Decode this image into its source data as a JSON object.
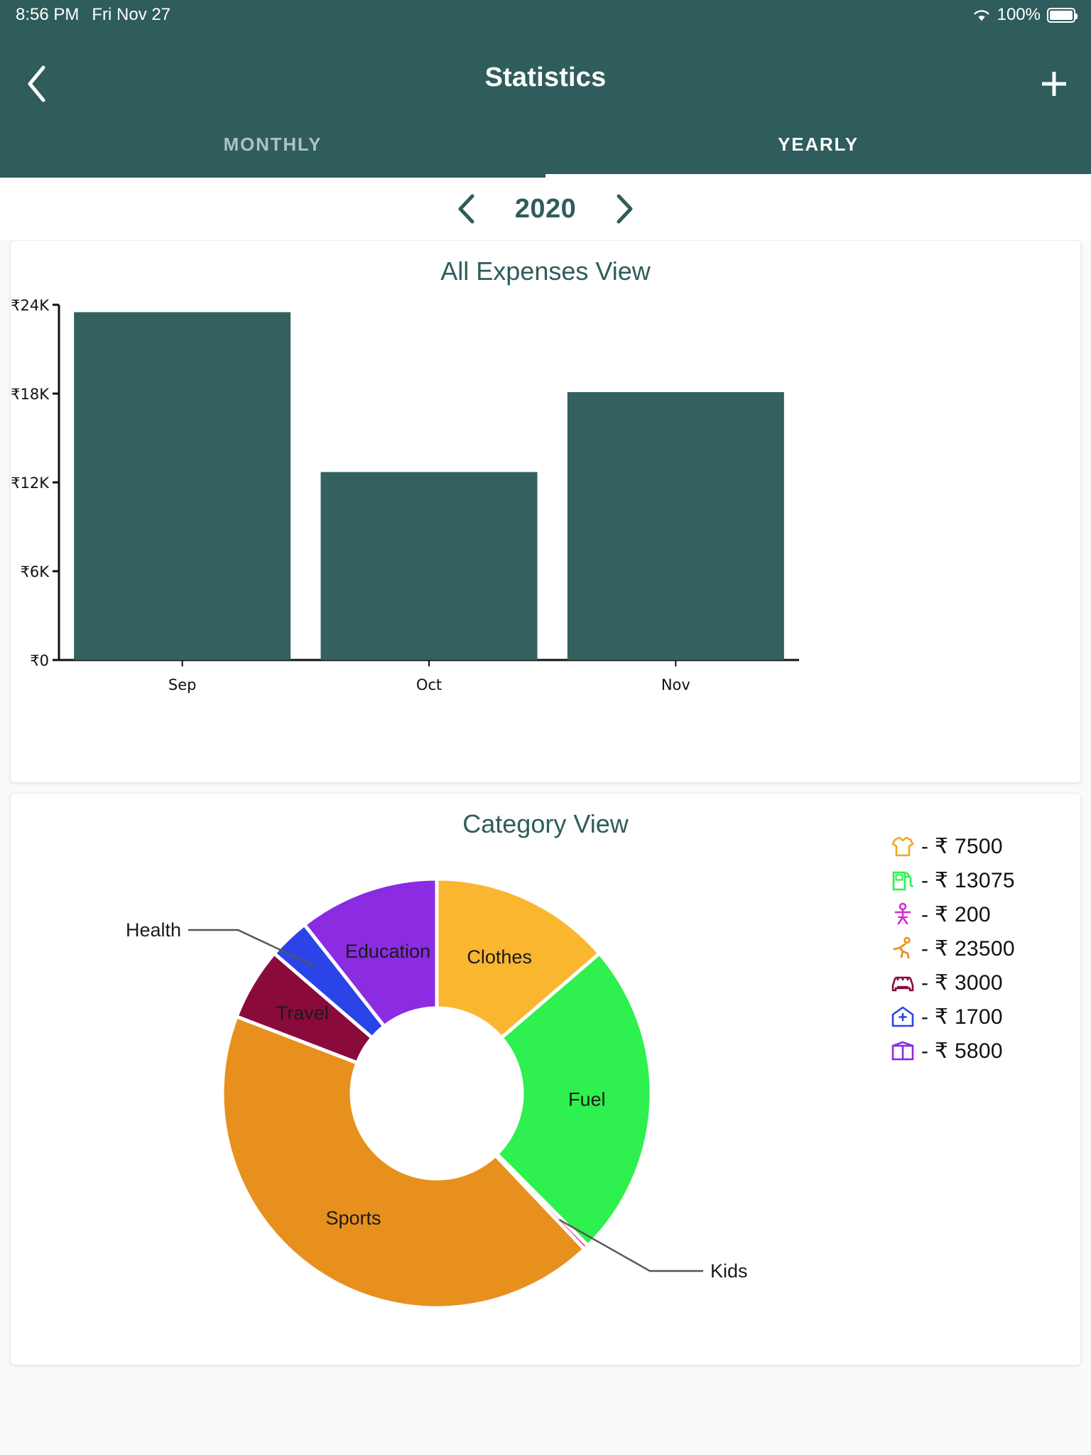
{
  "statusbar": {
    "time": "8:56 PM",
    "date": "Fri Nov 27",
    "battery_percent": "100%",
    "wifi_icon": "wifi-icon",
    "battery_icon": "battery-icon"
  },
  "appbar": {
    "title": "Statistics",
    "back_icon": "chevron-left-icon",
    "add_icon": "plus-icon",
    "tabs": [
      {
        "label": "MONTHLY",
        "active": false
      },
      {
        "label": "YEARLY",
        "active": true
      }
    ]
  },
  "year_selector": {
    "prev_icon": "chevron-left-icon",
    "next_icon": "chevron-right-icon",
    "year": "2020"
  },
  "colors": {
    "brand": "#2e5d5b",
    "bar": "#33615f",
    "card_bg": "#ffffff",
    "page_bg": "#fafafa",
    "axis": "#111111"
  },
  "chart_data": [
    {
      "type": "bar",
      "title": "All Expenses View",
      "categories": [
        "Sep",
        "Oct",
        "Nov"
      ],
      "values": [
        23500,
        12700,
        18100
      ],
      "xlabel": "",
      "ylabel": "",
      "ylim": [
        0,
        24000
      ],
      "ytick_labels": [
        "₹24K",
        "₹18K",
        "₹12K",
        "₹6K",
        "₹0"
      ],
      "ytick_values": [
        24000,
        18000,
        12000,
        6000,
        0
      ],
      "grid": false,
      "legend": "none",
      "bar_color": "#33615f"
    },
    {
      "type": "pie",
      "title": "Category View",
      "donut": true,
      "labels": [
        "Clothes",
        "Fuel",
        "Kids",
        "Sports",
        "Travel",
        "Health",
        "Education"
      ],
      "values": [
        7500,
        13075,
        200,
        23500,
        3000,
        1700,
        5800
      ],
      "colors": [
        "#fbb630",
        "#2ef04e",
        "#f53ba8",
        "#e8901e",
        "#8b0a3c",
        "#2b44e8",
        "#8b2be2"
      ],
      "total": 54775,
      "leader_labels": [
        "Health",
        "Kids"
      ],
      "inner_labels": [
        "Education",
        "Clothes",
        "Fuel",
        "Sports",
        "Travel"
      ],
      "legend_position": "right",
      "legend": [
        {
          "icon": "tshirt-icon",
          "color": "#fbb630",
          "value": "- ₹ 7500",
          "category": "Clothes"
        },
        {
          "icon": "fuel-pump-icon",
          "color": "#2ef04e",
          "value": "- ₹ 13075",
          "category": "Fuel"
        },
        {
          "icon": "child-icon",
          "color": "#d52ad5",
          "value": "- ₹ 200",
          "category": "Kids"
        },
        {
          "icon": "running-icon",
          "color": "#e8901e",
          "value": "- ₹ 23500",
          "category": "Sports"
        },
        {
          "icon": "car-icon",
          "color": "#8b0a3c",
          "value": "- ₹ 3000",
          "category": "Travel"
        },
        {
          "icon": "hospital-icon",
          "color": "#2b44e8",
          "value": "- ₹ 1700",
          "category": "Health"
        },
        {
          "icon": "book-icon",
          "color": "#8b2be2",
          "value": "- ₹ 5800",
          "category": "Education"
        }
      ]
    }
  ]
}
